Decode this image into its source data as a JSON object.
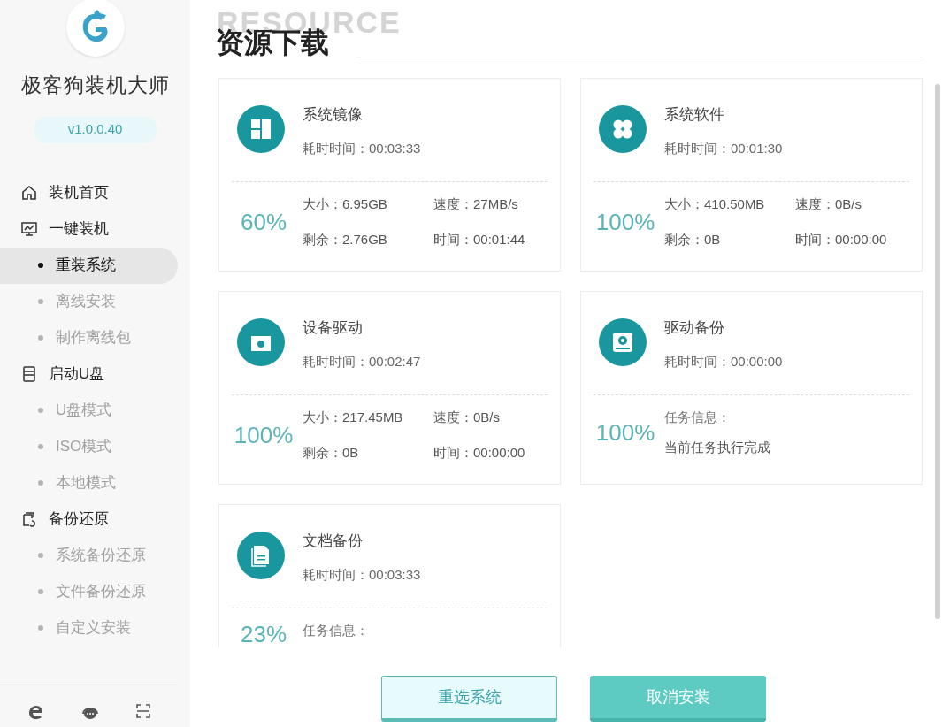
{
  "sidebar": {
    "app_name": "极客狗装机大师",
    "version": "v1.0.0.40",
    "nav": [
      {
        "label": "装机首页",
        "kind": "section",
        "selected": false
      },
      {
        "label": "一键装机",
        "kind": "section",
        "selected": false
      },
      {
        "label": "重装系统",
        "kind": "sub",
        "selected": true
      },
      {
        "label": "离线安装",
        "kind": "sub",
        "selected": false
      },
      {
        "label": "制作离线包",
        "kind": "sub",
        "selected": false
      },
      {
        "label": "启动U盘",
        "kind": "section",
        "selected": false
      },
      {
        "label": "U盘模式",
        "kind": "sub",
        "selected": false
      },
      {
        "label": "ISO模式",
        "kind": "sub",
        "selected": false
      },
      {
        "label": "本地模式",
        "kind": "sub",
        "selected": false
      },
      {
        "label": "备份还原",
        "kind": "section",
        "selected": false
      },
      {
        "label": "系统备份还原",
        "kind": "sub",
        "selected": false
      },
      {
        "label": "文件备份还原",
        "kind": "sub",
        "selected": false
      },
      {
        "label": "自定义安装",
        "kind": "sub",
        "selected": false
      }
    ]
  },
  "header": {
    "watermark": "RESOURCE",
    "title": "资源下载"
  },
  "cards": [
    {
      "title": "系统镜像",
      "elapsed": "耗时时间：00:03:33",
      "percent": "60%",
      "kind": "stats",
      "stats": [
        "大小：6.95GB",
        "速度：27MB/s",
        "剩余：2.76GB",
        "时间：00:01:44"
      ]
    },
    {
      "title": "系统软件",
      "elapsed": "耗时时间：00:01:30",
      "percent": "100%",
      "kind": "stats",
      "stats": [
        "大小：410.50MB",
        "速度：0B/s",
        "剩余：0B",
        "时间：00:00:00"
      ]
    },
    {
      "title": "设备驱动",
      "elapsed": "耗时时间：00:02:47",
      "percent": "100%",
      "kind": "stats",
      "stats": [
        "大小：217.45MB",
        "速度：0B/s",
        "剩余：0B",
        "时间：00:00:00"
      ]
    },
    {
      "title": "驱动备份",
      "elapsed": "耗时时间：00:00:00",
      "percent": "100%",
      "kind": "info",
      "info_label": "任务信息：",
      "info": "当前任务执行完成"
    },
    {
      "title": "文档备份",
      "elapsed": "耗时时间：00:03:33",
      "percent": "23%",
      "kind": "info",
      "info_label": "任务信息："
    }
  ],
  "buttons": [
    {
      "label": "重选系统",
      "kind": "secondary"
    },
    {
      "label": "取消安装",
      "kind": "primary"
    }
  ]
}
